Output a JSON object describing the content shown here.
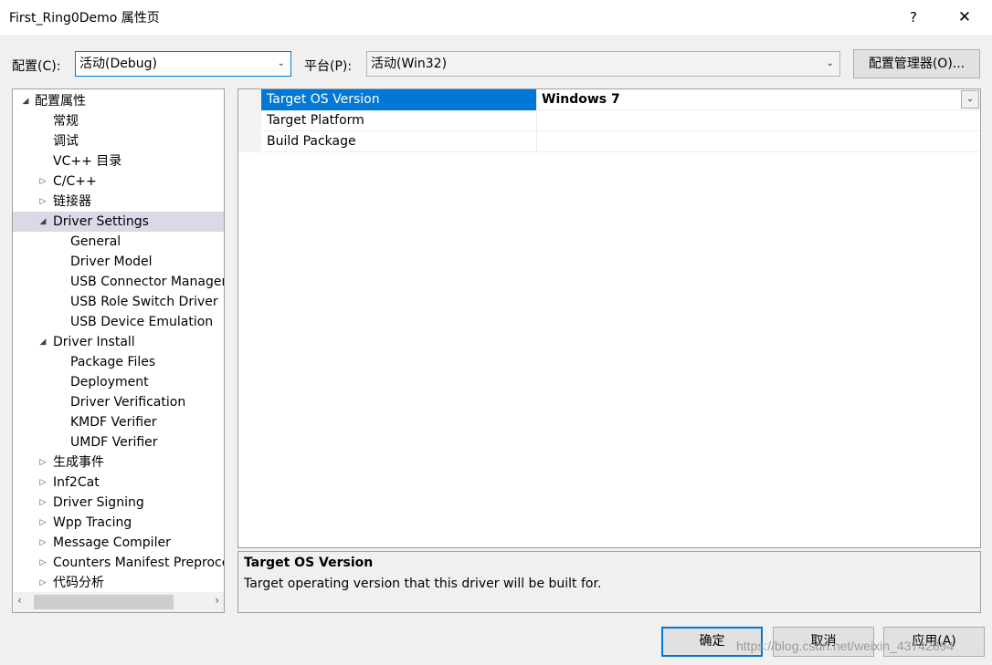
{
  "window": {
    "title": "First_Ring0Demo 属性页",
    "help_label": "?",
    "close_label": "✕"
  },
  "toolbar": {
    "config_label": "配置(C):",
    "config_value": "活动(Debug)",
    "platform_label": "平台(P):",
    "platform_value": "活动(Win32)",
    "config_manager_label": "配置管理器(O)..."
  },
  "tree": {
    "items": [
      {
        "label": "配置属性",
        "expander": "◢"
      },
      {
        "label": "常规",
        "expander": ""
      },
      {
        "label": "调试",
        "expander": ""
      },
      {
        "label": "VC++ 目录",
        "expander": ""
      },
      {
        "label": "C/C++",
        "expander": "▷"
      },
      {
        "label": "链接器",
        "expander": "▷"
      },
      {
        "label": "Driver Settings",
        "expander": "◢"
      },
      {
        "label": "General",
        "expander": ""
      },
      {
        "label": "Driver Model",
        "expander": ""
      },
      {
        "label": "USB Connector Manager",
        "expander": ""
      },
      {
        "label": "USB Role Switch Driver",
        "expander": ""
      },
      {
        "label": "USB Device Emulation",
        "expander": ""
      },
      {
        "label": "Driver Install",
        "expander": "◢"
      },
      {
        "label": "Package Files",
        "expander": ""
      },
      {
        "label": "Deployment",
        "expander": ""
      },
      {
        "label": "Driver Verification",
        "expander": ""
      },
      {
        "label": "KMDF Verifier",
        "expander": ""
      },
      {
        "label": "UMDF Verifier",
        "expander": ""
      },
      {
        "label": "生成事件",
        "expander": "▷"
      },
      {
        "label": "Inf2Cat",
        "expander": "▷"
      },
      {
        "label": "Driver Signing",
        "expander": "▷"
      },
      {
        "label": "Wpp Tracing",
        "expander": "▷"
      },
      {
        "label": "Message Compiler",
        "expander": "▷"
      },
      {
        "label": "Counters Manifest Preprocessor",
        "expander": "▷"
      },
      {
        "label": "代码分析",
        "expander": "▷"
      }
    ],
    "selected_index": 6,
    "scroll_left": "‹",
    "scroll_right": "›"
  },
  "grid": {
    "rows": [
      {
        "name": "Target OS Version",
        "value": "Windows 7"
      },
      {
        "name": "Target Platform",
        "value": ""
      },
      {
        "name": "Build Package",
        "value": ""
      }
    ]
  },
  "description": {
    "title": "Target OS Version",
    "text": "Target operating version that this driver will be built for."
  },
  "buttons": {
    "ok": "确定",
    "cancel": "取消",
    "apply": "应用(A)"
  },
  "watermark": "https://blog.csdn.net/weixin_43742894",
  "colors": {
    "selection_blue": "#0078d7",
    "tree_selected": "#d9d9e8",
    "window_bg": "#f0f0f0"
  }
}
